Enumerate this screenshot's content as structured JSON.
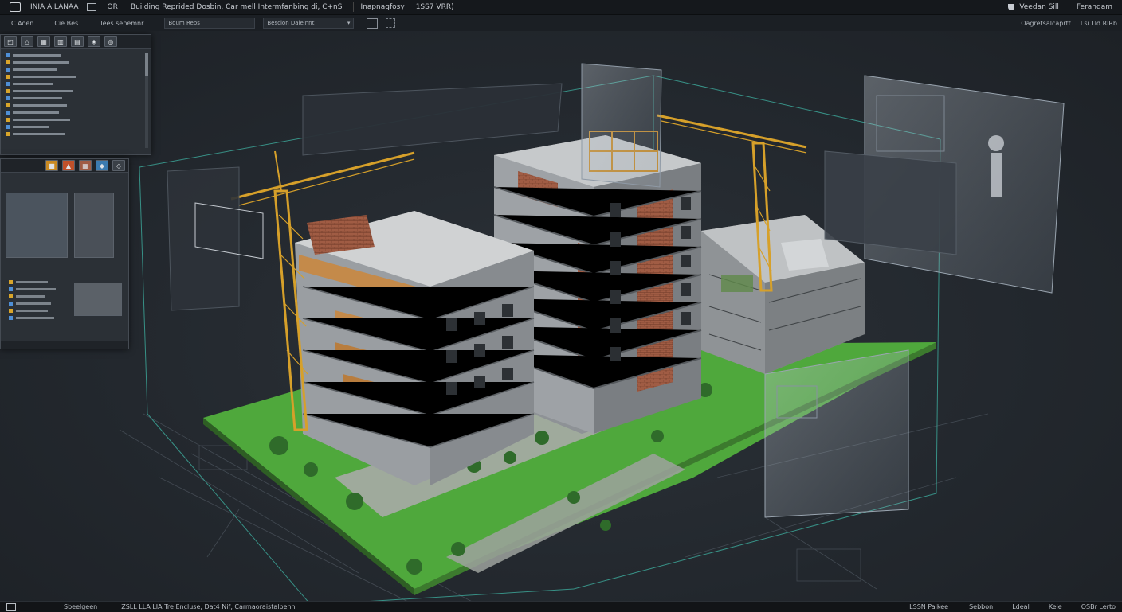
{
  "window": {
    "title_left": "INIA AILANAA",
    "menu_ca": "OR",
    "document_title": "Building Reprided Dosbin, Car mell Intermfanbing di, C+nS",
    "mode": "Inapnagfosy",
    "version": "1SS7 VRR)",
    "right_label": "Veedan Sill",
    "right_menu": "Ferandam"
  },
  "toolbar": {
    "btn1": "C Aoen",
    "btn2": "Cie Bes",
    "btn3": "Iees sepemnr",
    "combo1": "Boum Rebs",
    "combo2": "Bescion Daleinnt",
    "right_text": "Oagretsalcaprtt",
    "right_small": "Lsi Lld RlRb"
  },
  "statusbar": {
    "left": "Sbeelgeen",
    "middle": "ZSLL LLA LIA Tre Encluse, Dat4 Nif, Carmaoraistalbenn",
    "r1": "LSSN Paikee",
    "r2": "Sebbon",
    "r3": "Ldeal",
    "r4": "Keie",
    "r5": "OSBr Lerto"
  },
  "icons": [
    "app-logo-icon",
    "window-icon",
    "cursor-icon",
    "triangle-icon",
    "grid-icon",
    "column-icon",
    "doc-icon",
    "layers-icon",
    "measure-icon",
    "globe-icon"
  ],
  "colors": {
    "accent_green": "#5fc04a",
    "crane_yellow": "#d6a02a",
    "brick": "#9a5a40",
    "frame_line": "#3fb4a4"
  }
}
